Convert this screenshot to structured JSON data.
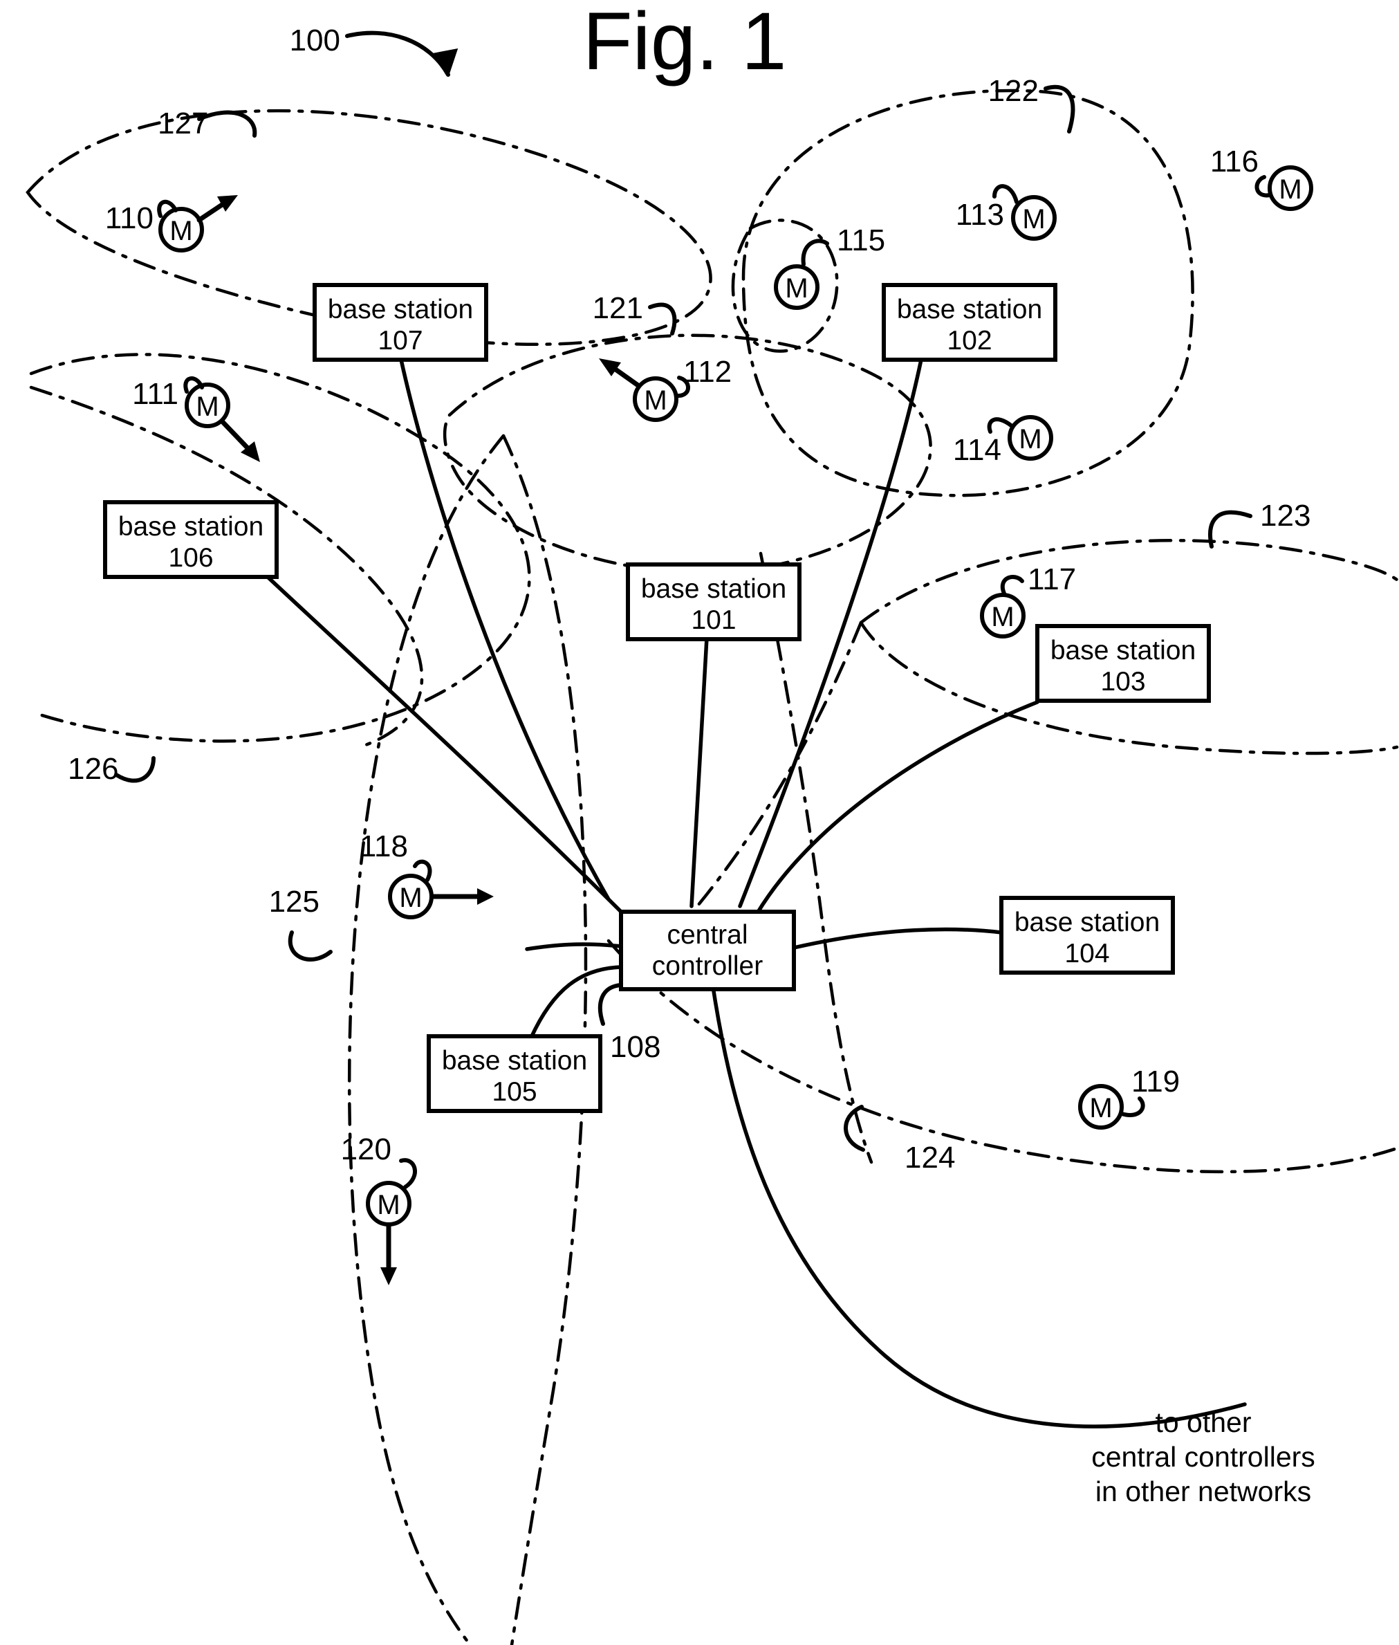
{
  "figure": {
    "title": "Fig. 1",
    "system_ref": "100"
  },
  "central_controller": {
    "line1": "central",
    "line2": "controller",
    "ref": "108"
  },
  "base_stations": [
    {
      "id": "bs101",
      "label": "base station",
      "number": "101"
    },
    {
      "id": "bs102",
      "label": "base station",
      "number": "102"
    },
    {
      "id": "bs103",
      "label": "base station",
      "number": "103"
    },
    {
      "id": "bs104",
      "label": "base station",
      "number": "104"
    },
    {
      "id": "bs105",
      "label": "base station",
      "number": "105"
    },
    {
      "id": "bs106",
      "label": "base station",
      "number": "106"
    },
    {
      "id": "bs107",
      "label": "base station",
      "number": "107"
    }
  ],
  "mobile_stations": [
    {
      "id": "ms110",
      "glyph": "M",
      "ref": "110",
      "motion": "up-right"
    },
    {
      "id": "ms111",
      "glyph": "M",
      "ref": "111",
      "motion": "down-right"
    },
    {
      "id": "ms112",
      "glyph": "M",
      "ref": "112",
      "motion": "up-left"
    },
    {
      "id": "ms113",
      "glyph": "M",
      "ref": "113",
      "motion": "none"
    },
    {
      "id": "ms114",
      "glyph": "M",
      "ref": "114",
      "motion": "none"
    },
    {
      "id": "ms115",
      "glyph": "M",
      "ref": "115",
      "motion": "none"
    },
    {
      "id": "ms116",
      "glyph": "M",
      "ref": "116",
      "motion": "none"
    },
    {
      "id": "ms117",
      "glyph": "M",
      "ref": "117",
      "motion": "none"
    },
    {
      "id": "ms118",
      "glyph": "M",
      "ref": "118",
      "motion": "right"
    },
    {
      "id": "ms119",
      "glyph": "M",
      "ref": "119",
      "motion": "none"
    },
    {
      "id": "ms120",
      "glyph": "M",
      "ref": "120",
      "motion": "down"
    }
  ],
  "cells": [
    {
      "id": "cell121",
      "ref": "121"
    },
    {
      "id": "cell122",
      "ref": "122"
    },
    {
      "id": "cell123",
      "ref": "123"
    },
    {
      "id": "cell124",
      "ref": "124"
    },
    {
      "id": "cell125",
      "ref": "125"
    },
    {
      "id": "cell126",
      "ref": "126"
    },
    {
      "id": "cell127",
      "ref": "127"
    }
  ],
  "notes": {
    "external_link_line1": "to other",
    "external_link_line2": "central controllers",
    "external_link_line3": "in other networks"
  },
  "colors": {
    "ink": "#000000",
    "paper": "#ffffff"
  }
}
